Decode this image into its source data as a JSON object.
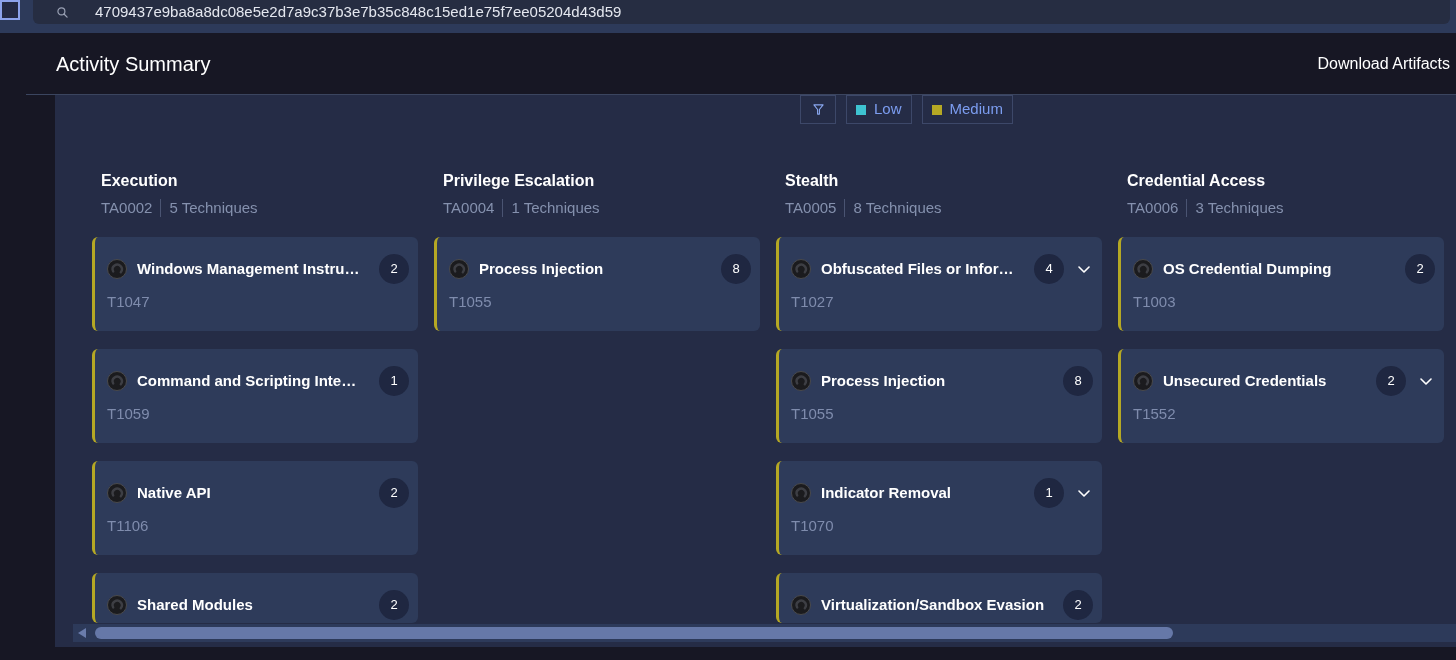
{
  "top_bar": {
    "search": {
      "value": "4709437e9ba8a8dc08e5e2d7a9c37b3e7b35c848c15ed1e75f7ee05204d43d59"
    }
  },
  "header": {
    "title": "Activity Summary",
    "action": "Download Artifacts"
  },
  "legend": [
    {
      "label": "Low",
      "color": "#3ec3d1"
    },
    {
      "label": "Medium",
      "color": "#b5a824"
    }
  ],
  "columns": [
    {
      "title": "Execution",
      "tactic_code": "TA0002",
      "technique_count": "5 Techniques",
      "cards": [
        {
          "title": "Windows Management Instru…",
          "technique_code": "T1047",
          "count": "2",
          "color": "#b5a824"
        },
        {
          "title": "Command and Scripting Inte…",
          "technique_code": "T1059",
          "count": "1",
          "color": "#b5a824"
        },
        {
          "title": "Native API",
          "technique_code": "T1106",
          "count": "2",
          "color": "#b5a824"
        },
        {
          "title": "Shared Modules",
          "count": "2",
          "color": "#b5a824"
        }
      ]
    },
    {
      "title": "Privilege Escalation",
      "tactic_code": "TA0004",
      "technique_count": "1 Techniques",
      "cards": [
        {
          "title": "Process Injection",
          "technique_code": "T1055",
          "count": "8",
          "color": "#b5a824"
        }
      ]
    },
    {
      "title": "Stealth",
      "tactic_code": "TA0005",
      "technique_count": "8 Techniques",
      "cards": [
        {
          "title": "Obfuscated Files or Infor…",
          "technique_code": "T1027",
          "count": "4",
          "expanded": false,
          "color": "#b5a824"
        },
        {
          "title": "Process Injection",
          "technique_code": "T1055",
          "count": "8",
          "color": "#b5a824"
        },
        {
          "title": "Indicator Removal",
          "technique_code": "T1070",
          "count": "1",
          "expanded": false,
          "color": "#b5a824"
        },
        {
          "title": "Virtualization/Sandbox Evasion",
          "count": "2",
          "color": "#b5a824"
        }
      ]
    },
    {
      "title": "Credential Access",
      "tactic_code": "TA0006",
      "technique_count": "3 Techniques",
      "cards": [
        {
          "title": "OS Credential Dumping",
          "technique_code": "T1003",
          "count": "2",
          "color": "#b5a824"
        },
        {
          "title": "Unsecured Credentials",
          "technique_code": "T1552",
          "count": "2",
          "expanded": false,
          "color": "#b5a824"
        }
      ]
    }
  ]
}
